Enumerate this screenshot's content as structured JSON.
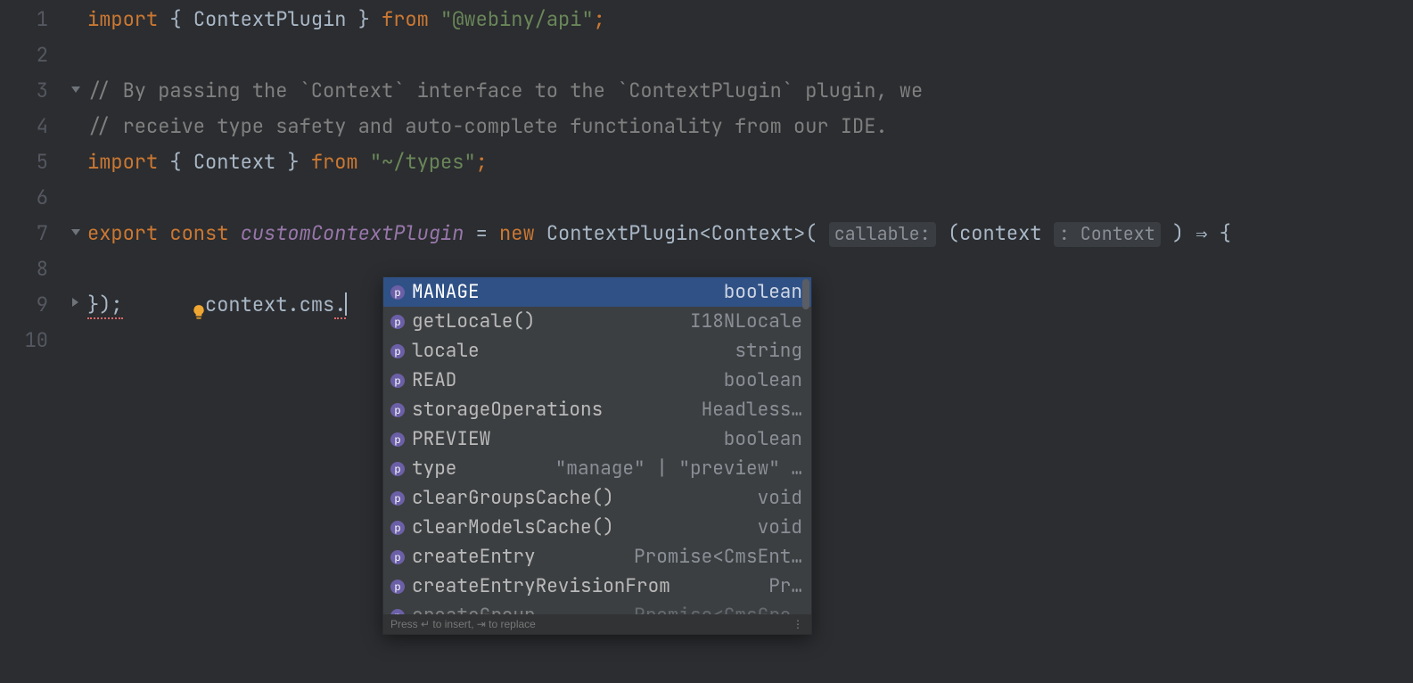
{
  "gutter": [
    "1",
    "2",
    "3",
    "4",
    "5",
    "6",
    "7",
    "8",
    "9",
    "10"
  ],
  "code": {
    "l1": {
      "import": "import",
      "brace_l": "{ ",
      "sym": "ContextPlugin",
      "brace_r": " }",
      "from": "from",
      "str": "\"@webiny/api\"",
      "semi": ";"
    },
    "l3": "// By passing the `Context` interface to the `ContextPlugin` plugin, we",
    "l4": "// receive type safety and auto-complete functionality from our IDE.",
    "l5": {
      "import": "import",
      "brace_l": "{ ",
      "sym": "Context",
      "brace_r": " }",
      "from": "from",
      "str": "\"~/types\"",
      "semi": ";"
    },
    "l7": {
      "export": "export",
      "const": "const",
      "name": "customContextPlugin",
      "eq": " = ",
      "new": "new",
      "ctor": "ContextPlugin",
      "lt": "<",
      "gtype": "Context",
      "gt": ">",
      "lp": "(",
      "hint_callable": "callable:",
      "arg_l": "(",
      "arg": "context",
      "hint_type": ": Context",
      "arg_r": ")",
      "arrow": " ⇒ ",
      "brace": "{"
    },
    "l8": {
      "indent": "    ",
      "obj": "context",
      "dot1": ".",
      "prop": "cms",
      "dot2": "."
    },
    "l9": {
      "close": "});"
    }
  },
  "popup": {
    "items": [
      {
        "name": "MANAGE",
        "type": "boolean",
        "selected": true
      },
      {
        "name": "getLocale()",
        "type": "I18NLocale"
      },
      {
        "name": "locale",
        "type": "string"
      },
      {
        "name": "READ",
        "type": "boolean"
      },
      {
        "name": "storageOperations",
        "type": "Headless…"
      },
      {
        "name": "PREVIEW",
        "type": "boolean"
      },
      {
        "name": "type",
        "type": "\"manage\" | \"preview\" …"
      },
      {
        "name": "clearGroupsCache()",
        "type": "void"
      },
      {
        "name": "clearModelsCache()",
        "type": "void"
      },
      {
        "name": "createEntry",
        "type": "Promise<CmsEnt…"
      },
      {
        "name": "createEntryRevisionFrom",
        "type": "Pr…"
      },
      {
        "name": "createGroup",
        "type": "Promise<CmsGro…",
        "cut": true
      }
    ],
    "footer": "Press ↵ to insert, ⇥ to replace",
    "footer_dots": "⋮"
  }
}
